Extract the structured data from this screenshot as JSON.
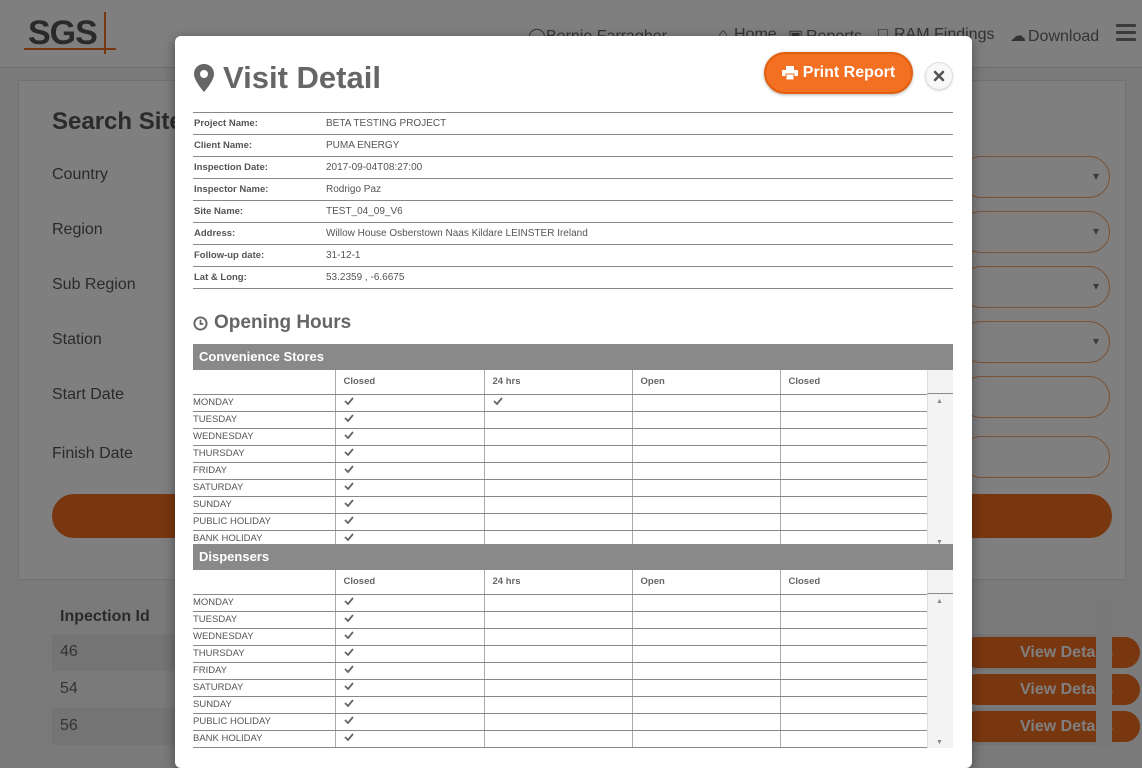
{
  "app": {
    "logo_text": "SGS",
    "nav": {
      "user": "Bernie Farragher",
      "home": "Home",
      "reports": "Reports",
      "findings": "RAM Findings",
      "download": "Download"
    }
  },
  "search": {
    "title": "Search Site",
    "fields": [
      "Country",
      "Region",
      "Sub Region",
      "Station",
      "Start Date",
      "Finish Date"
    ]
  },
  "results": {
    "header": "Inpection Id",
    "rows": [
      "46",
      "54",
      "56"
    ],
    "view_label": "View Details"
  },
  "modal": {
    "title": "Visit Detail",
    "print_label": "Print Report",
    "info": [
      {
        "label": "Project Name:",
        "value": "BETA TESTING PROJECT"
      },
      {
        "label": "Client Name:",
        "value": "PUMA ENERGY"
      },
      {
        "label": "Inspection Date:",
        "value": "2017-09-04T08:27:00"
      },
      {
        "label": "Inspector Name:",
        "value": "Rodrigo Paz"
      },
      {
        "label": "Site Name:",
        "value": "TEST_04_09_V6"
      },
      {
        "label": "Address:",
        "value": "Willow House Osberstown Naas Kildare LEINSTER Ireland"
      },
      {
        "label": "Follow-up date:",
        "value": "31-12-1"
      },
      {
        "label": "Lat & Long:",
        "value": "53.2359 , -6.6675"
      }
    ],
    "opening_hours_title": "Opening Hours",
    "columns": [
      "",
      "Closed",
      "24 hrs",
      "Open",
      "Closed"
    ],
    "sections": [
      {
        "name": "Convenience Stores",
        "rows": [
          {
            "day": "MONDAY",
            "closed": true,
            "h24": true
          },
          {
            "day": "TUESDAY",
            "closed": true,
            "h24": false
          },
          {
            "day": "WEDNESDAY",
            "closed": true,
            "h24": false
          },
          {
            "day": "THURSDAY",
            "closed": true,
            "h24": false
          },
          {
            "day": "FRIDAY",
            "closed": true,
            "h24": false
          },
          {
            "day": "SATURDAY",
            "closed": true,
            "h24": false
          },
          {
            "day": "SUNDAY",
            "closed": true,
            "h24": false
          },
          {
            "day": "PUBLIC HOLIDAY",
            "closed": true,
            "h24": false
          },
          {
            "day": "BANK HOLIDAY",
            "closed": true,
            "h24": false
          }
        ]
      },
      {
        "name": "Dispensers",
        "rows": [
          {
            "day": "MONDAY",
            "closed": true,
            "h24": false
          },
          {
            "day": "TUESDAY",
            "closed": true,
            "h24": false
          },
          {
            "day": "WEDNESDAY",
            "closed": true,
            "h24": false
          },
          {
            "day": "THURSDAY",
            "closed": true,
            "h24": false
          },
          {
            "day": "FRIDAY",
            "closed": true,
            "h24": false
          },
          {
            "day": "SATURDAY",
            "closed": true,
            "h24": false
          },
          {
            "day": "SUNDAY",
            "closed": true,
            "h24": false
          },
          {
            "day": "PUBLIC HOLIDAY",
            "closed": true,
            "h24": false
          },
          {
            "day": "BANK HOLIDAY",
            "closed": true,
            "h24": false
          }
        ]
      }
    ]
  },
  "colors": {
    "accent": "#f36f21",
    "section_header": "#898989",
    "overlay": "rgba(0,0,0,0.5)"
  }
}
